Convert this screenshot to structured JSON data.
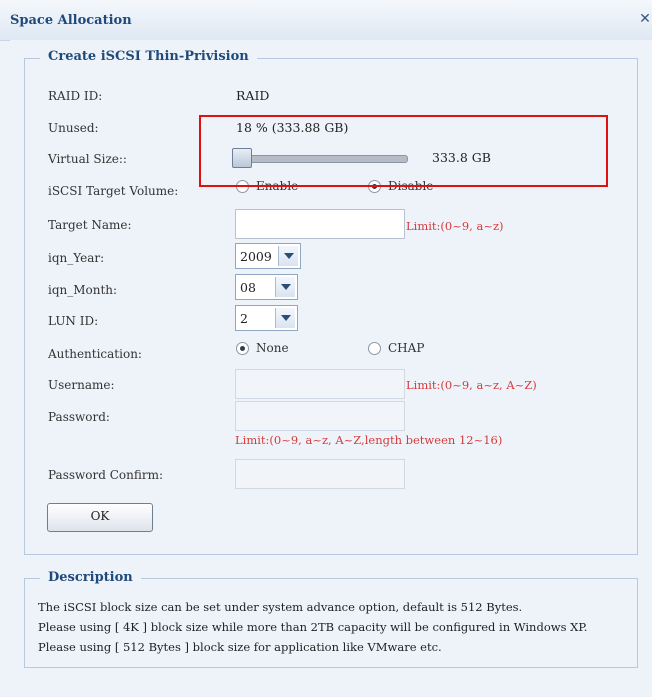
{
  "window": {
    "title": "Space Allocation",
    "close_icon": "close-icon"
  },
  "create_box": {
    "legend": "Create iSCSI Thin-Privision",
    "raid_id": {
      "label": "RAID ID:",
      "value": "RAID"
    },
    "unused": {
      "label": "Unused:",
      "value": "18 % (333.88 GB)"
    },
    "virtual_size": {
      "label": "Virtual Size::",
      "value": "333.8 GB",
      "slider_level": 0.02
    },
    "target_volume": {
      "label": "iSCSI Target Volume:",
      "enable": "Enable",
      "disable": "Disable",
      "selected": "Disable"
    },
    "target_name": {
      "label": "Target Name:",
      "value": "",
      "limit": "Limit:(0~9, a~z)"
    },
    "iqn_year": {
      "label": "iqn_Year:",
      "value": "2009"
    },
    "iqn_month": {
      "label": "iqn_Month:",
      "value": "08"
    },
    "lun_id": {
      "label": "LUN ID:",
      "value": "2"
    },
    "authentication": {
      "label": "Authentication:",
      "none": "None",
      "chap": "CHAP",
      "selected": "None"
    },
    "username": {
      "label": "Username:",
      "value": "",
      "limit": "Limit:(0~9, a~z, A~Z)"
    },
    "password": {
      "label": "Password:",
      "value": "",
      "limit": "Limit:(0~9, a~z, A~Z,length between 12~16)"
    },
    "password_confirm": {
      "label": "Password Confirm:",
      "value": ""
    },
    "ok_label": "OK"
  },
  "description_box": {
    "legend": "Description",
    "lines": [
      "The iSCSI block size can be set under system advance option, default is 512 Bytes.",
      "Please using [ 4K ] block size while more than 2TB capacity will be configured in Windows XP.",
      "Please using [ 512 Bytes ] block size for application like VMware etc."
    ]
  },
  "colors": {
    "accent": "#1f4a7c",
    "limit_text": "#d63b3b",
    "highlight_box": "#e01010"
  }
}
